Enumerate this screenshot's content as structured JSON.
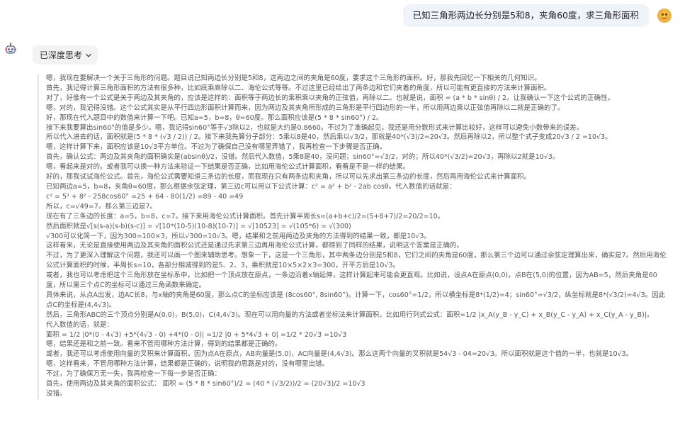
{
  "user": {
    "message": "已知三角形两边长分别是5和8，夹角60度，求三角形面积"
  },
  "assistant": {
    "think_toggle_label": "已深度思考",
    "thinking_lines": [
      "嗯，我现在要解决一个关于三角形的问题。题目说已知两边长分别是5和8，这两边之间的夹角是60度，要求这个三角形的面积。好，那我先回忆一下相关的几何知识。",
      "首先，我记得计算三角形面积的方法有很多种，比如底乘高除以二、海伦公式等等。不过这里已经给出了两条边和它们夹着的角度，所以可能有更直接的方法来计算面积。",
      "对了，好像有一个公式是关于两边及其夹角的，应该是这样的：面积等于两边长的乘积乘以夹角的正弦值，再除以二。也就是说，面积 = (a * b * sinθ) / 2。让我确认一下这个公式的正确性。",
      "嗯，对的，我记得没错。这个公式其实是从平行四边形面积计算而来，因为两边及其夹角所形成的三角形是平行四边形的一半，所以用两边乘以正弦值再除以二就是正确的了。",
      "好，那现在代入题目中的数值来计算一下吧。已知a=5，b=8，θ=60度。那么面积应该是(5 * 8 * sin60°) / 2。",
      "接下来我要算出sin60°的值是多少。嗯，我记得sin60°等于√3除以2，也就是大约是0.8660。不过为了准确起见，我还是用分数形式来计算比较好，这样可以避免小数带来的误差。",
      "所以代入进去的话，面积就是(5 * 8 * (√3 / 2)) / 2。接下来我先算分子部分：5乘以8是40，然后乘以√3/2，那就是40*(√3)/2=20√3。然后再除以2，所以整个式子变成20√3 / 2 =10√3。",
      "嗯，这样计算下来，面积应该是10√3平方单位。不过为了确保自己没有哪里弄错了，我再检查一下步骤是否正确。",
      "首先，确认公式：两边及其夹角的面积确实是(absinθ)/2，没错。然后代入数值，5乘8是40，没问题；sin60°=√3/2，对的；所以40*(√3/2)=20√3，再除以2就是10√3。",
      "嗯，看起来是对的。或者我可以换一种方法来验证一下结果是否正确，比如用海伦公式计算面积，看看是不是一样的结果。",
      "好的，那我试试海伦公式。首先，海伦公式需要知道三条边的长度，而我现在只有两条边和夹角，所以可以先求出第三条边的长度，然后再用海伦公式来计算面积。",
      "已知两边a=5，b=8，夹角θ=60度，那么根据余弦定理，第三边c可以用以下公式计算：c² = a² + b² - 2ab cosθ。代入数值的话就是：",
      "c² = 5² + 8² - 258cos60° =25 + 64 - 80(1/2) =89 - 40 =49",
      "所以，c=√49=7。那么第三边是7。",
      "现在有了三条边的长度：a=5，b=8，c=7。接下来用海伦公式计算面积。首先计算半周长s=(a+b+c)/2=(5+8+7)/2=20/2=10。",
      "然后面积就是√[s(s-a)(s-b)(s-c)] = √[10*(10-5)(10-8)(10-7)] = √[10523] = √(105*6) = √(300)",
      "√300可以化简一下，因为300=100×3，所以√300=10√3。嗯，结果和之前用两边及夹角的方法得到的结果一致，都是10√3。",
      "这样看来，无论是直接使用两边及其夹角的面积公式还是通过先求第三边再用海伦公式计算，都得到了同样的结果，说明这个答案是正确的。",
      "不过，为了更深入理解这个问题，我还可以画一个图来辅助思考。想象一下，这是一个三角形，其中两条边分别是5和8，它们之间的夹角是60度，那么第三个边可以通过余弦定理算出来，确实是7。然后用海伦公式计算面积的时候，半周长s=10，各部分相减得到的是5、2、3，乘积就是10×5×2×3=300，开平方后是10√3。",
      "或者，我也可以考虑把这个三角形放在坐标系中，比如把一个顶点放在原点，一条边沿着x轴延伸，这样计算起来可能会更直观。比如说，设点A在原点(0,0)，点B在(5,0)的位置，因为AB=5，然后夹角是60度，所以第三个点C的坐标可以通过三角函数来确定。",
      "具体来说，从点A出发，边AC长8，与x轴的夹角是60度，那么点C的坐标应该是 (8cos60°, 8sin60°)。计算一下，cos60°=1/2，所以横坐标是8*(1/2)=4；sin60°=√3/2，纵坐标就是8*(√3/2)=4√3。因此点C的坐标是(4,4√3)。",
      "然后，三角形ABC的三个顶点分别是A(0,0)，B(5,0)，C(4,4√3)。现在可以用向量的方法或者坐标法来计算面积。比如用行列式公式：面积=1/2 |x_A(y_B - y_C) + x_B(y_C - y_A) + x_C(y_A - y_B)|。",
      "代入数值的话，就是：",
      "面积 = 1/2 |0*(0 - 4√3) +5*(4√3 - 0) +4*(0 - 0)| =1/2 |0 + 5*4√3 + 0| =1/2 * 20√3 =10√3",
      "嗯，结果还是和之前一致。看来不管用哪种方法计算，得到的结果都是正确的。",
      "或者，我还可以考虑使用向量的叉积来计算面积。因为点A在原点，AB向量是(5,0)，AC向量是(4,4√3)。那么这两个向量的叉积就是54√3 - 04=20√3。所以面积就是这个值的一半，也就是10√3。",
      "嗯，这样看来，不管用哪种方法计算，结果都是正确的，说明我的思路是对的，没有哪里出错。",
      "不过，为了确保万无一失，我再检查一下每一步是否正确：",
      "首先，使用两边及其夹角的面积公式： 面积 = (5 * 8 * sin60°)/2 = (40 * (√3/2))/2 = (20√3)/2 =10√3",
      "没错。"
    ]
  },
  "icons": {
    "user_avatar": "smiley-face-icon",
    "bot_avatar": "robot-icon",
    "toggle": "chevron-down-icon"
  },
  "colors": {
    "user_bubble_bg": "#eff3fa",
    "toggle_bg": "#f3f3f3",
    "think_border": "#e4e4e4",
    "think_text": "#555555"
  }
}
